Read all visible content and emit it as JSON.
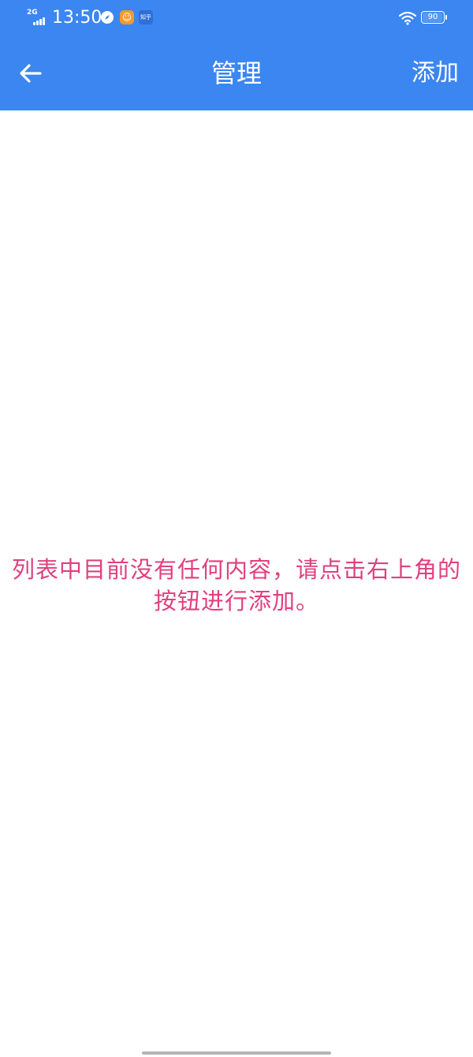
{
  "status_bar": {
    "network_type": "2G",
    "time": "13:50",
    "zhihu_label": "知乎",
    "battery_level": "90",
    "background_color": "#3b86f0"
  },
  "nav_bar": {
    "back_icon": "arrow-left-icon",
    "title": "管理",
    "add_label": "添加",
    "background_color": "#3b86f0"
  },
  "main": {
    "empty_message": "列表中目前没有任何内容，请点击右上角的按钮进行添加。",
    "message_color": "#e0407e"
  }
}
